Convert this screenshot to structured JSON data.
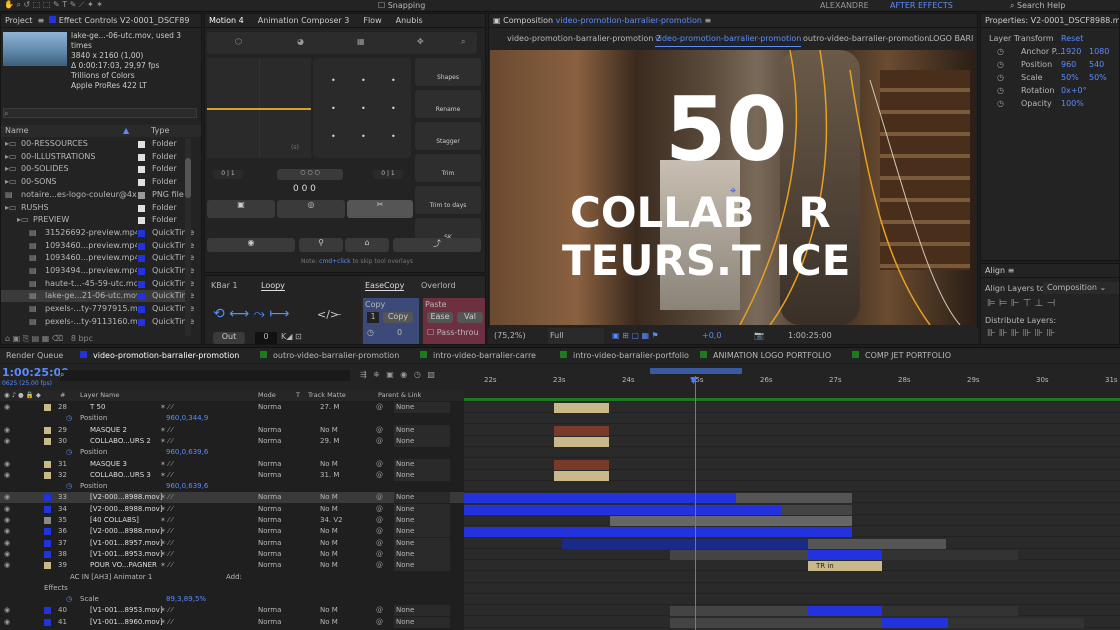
{
  "toolbar": {
    "user": "ALEXANDRE",
    "workspace": "AFTER EFFECTS",
    "search": "Search Help",
    "snapping": "Snapping"
  },
  "project": {
    "title": "Project",
    "effect_controls": "Effect Controls V2-0001_DSCF89",
    "file": "lake-ge...-06-utc.mov",
    "used": ", used 3 times",
    "res": "3840 x 2160 (1,00)",
    "dur": "Δ 0:00:17:03, 29,97 fps",
    "colors": "Trillions of Colors",
    "codec": "Apple ProRes 422 LT",
    "col_name": "Name",
    "col_type": "Type",
    "bpc": "8 bpc",
    "items": [
      {
        "name": "00-RESSOURCES",
        "type": "Folder",
        "color": "#e0e0e0"
      },
      {
        "name": "00-ILLUSTRATIONS",
        "type": "Folder",
        "color": "#e0e0e0"
      },
      {
        "name": "00-SOLIDES",
        "type": "Folder",
        "color": "#e0e0e0"
      },
      {
        "name": "00-SONS",
        "type": "Folder",
        "color": "#e0e0e0"
      },
      {
        "name": "notaire...es-logo-couleur@4x.png",
        "type": "PNG file",
        "color": "#9a9a9a"
      },
      {
        "name": "RUSHS",
        "type": "Folder",
        "color": "#e0e0e0"
      },
      {
        "name": "PREVIEW",
        "type": "Folder",
        "color": "#e0e0e0"
      },
      {
        "name": "31526692-preview.mp4",
        "type": "QuickTime",
        "color": "#2233dd"
      },
      {
        "name": "1093460...preview.mp4",
        "type": "QuickTime",
        "color": "#2233dd"
      },
      {
        "name": "1093460...preview.mp4",
        "type": "QuickTime",
        "color": "#2233dd"
      },
      {
        "name": "1093494...preview.mp4",
        "type": "QuickTime",
        "color": "#2233dd"
      },
      {
        "name": "haute-t...-45-59-utc.mov",
        "type": "QuickTime",
        "color": "#2233dd"
      },
      {
        "name": "lake-ge...21-06-utc.mov",
        "type": "QuickTime",
        "color": "#2233dd"
      },
      {
        "name": "pexels-...ty-7797915.mp4",
        "type": "QuickTime",
        "color": "#2233dd"
      },
      {
        "name": "pexels-...ty-9113160.mp4",
        "type": "QuickTime",
        "color": "#2233dd"
      }
    ]
  },
  "motion": {
    "tabs": [
      "Motion 4",
      "Animation Composer 3",
      "Flow",
      "Anubis"
    ],
    "side": [
      "Shapes",
      "Rename",
      "Stagger",
      "Trim",
      "Trim to days",
      "SK"
    ],
    "counter": "0 0 0",
    "hint_pre": "Note:",
    "hint_link": "cmd+click",
    "hint_post": "to skip tool overlays",
    "curve_label": "(s)"
  },
  "kbar": {
    "tabs": [
      "KBar 1",
      "Loopy",
      "EaseCopy",
      "Overlord"
    ],
    "out": "Out",
    "zero": "0",
    "copy": "Copy",
    "copy_btn": "Copy",
    "paste": "Paste",
    "ease": "Ease",
    "val": "Val",
    "pass": "Pass-throu",
    "count": "0",
    "one": "1"
  },
  "composition": {
    "tab": "Composition",
    "name": "video-promotion-barralier-promotion",
    "tabs": [
      "video-promotion-barralier-promotion 2",
      "video-promotion-barralier-promotion",
      "outro-video-barralier-promotion",
      "LOGO BARI"
    ],
    "big": "50",
    "line1": "COLLAB   R",
    "line2": "TEURS.T ICE",
    "zoom": "(75,2%)",
    "quality": "Full",
    "time": "1:00:25:00",
    "plus": "+0,0"
  },
  "properties": {
    "title": "Properties: V2-0001_DSCF8988.mov",
    "section": "Layer Transform",
    "reset": "Reset",
    "rows": [
      {
        "label": "Anchor P...",
        "v1": "1920",
        "v2": "1080"
      },
      {
        "label": "Position",
        "v1": "960",
        "v2": "540"
      },
      {
        "label": "Scale",
        "v1": "50%",
        "v2": "50%"
      },
      {
        "label": "Rotation",
        "v1": "0x+0°",
        "v2": ""
      },
      {
        "label": "Opacity",
        "v1": "100%",
        "v2": ""
      }
    ]
  },
  "align": {
    "title": "Align",
    "align_to": "Align Layers to:",
    "target": "Composition",
    "distribute": "Distribute Layers:"
  },
  "timeline": {
    "render_queue": "Render Queue",
    "tabs": [
      "video-promotion-barralier-promotion",
      "outro-video-barralier-promotion",
      "intro-video-barralier-carre",
      "intro-video-barralier-portfolio",
      "ANIMATION LOGO PORTFOLIO",
      "COMP JET PORTFOLIO"
    ],
    "timecode": "1:00:25:00",
    "fps": "0625 (25.00 fps)",
    "headers": {
      "num": "#",
      "name": "Layer Name",
      "mode": "Mode",
      "t": "T",
      "matte": "Track Matte",
      "parent": "Parent & Link"
    },
    "ruler": [
      "22s",
      "23s",
      "24s",
      "25s",
      "26s",
      "27s",
      "28s",
      "29s",
      "30s",
      "31s"
    ],
    "layers": [
      {
        "num": "28",
        "name": "T  50",
        "mode": "Norma",
        "matte": "27. M",
        "parent": "None",
        "color": "#c9b88a",
        "kind": "layer"
      },
      {
        "name": "Position",
        "value": "960,0,344,9",
        "kind": "prop"
      },
      {
        "num": "29",
        "name": "MASQUE 2",
        "mode": "Norma",
        "matte": "No M",
        "parent": "None",
        "color": "#c9b88a",
        "kind": "layer"
      },
      {
        "num": "30",
        "name": "COLLABO...URS 2",
        "mode": "Norma",
        "matte": "29. M",
        "parent": "None",
        "color": "#c9b88a",
        "kind": "layer"
      },
      {
        "name": "Position",
        "value": "960,0,639,6",
        "kind": "prop"
      },
      {
        "num": "31",
        "name": "MASQUE 3",
        "mode": "Norma",
        "matte": "No M",
        "parent": "None",
        "color": "#c9b88a",
        "kind": "layer"
      },
      {
        "num": "32",
        "name": "COLLABO...URS 3",
        "mode": "Norma",
        "matte": "31. M",
        "parent": "None",
        "color": "#c9b88a",
        "kind": "layer"
      },
      {
        "name": "Position",
        "value": "960,0,639,6",
        "kind": "prop"
      },
      {
        "num": "33",
        "name": "[V2-000...8988.mov]",
        "mode": "Norma",
        "matte": "No M",
        "parent": "None",
        "color": "#2233dd",
        "kind": "layer",
        "sel": true
      },
      {
        "num": "34",
        "name": "[V2-000...8988.mov]",
        "mode": "Norma",
        "matte": "No M",
        "parent": "None",
        "color": "#2233dd",
        "kind": "layer"
      },
      {
        "num": "35",
        "name": "[40 COLLABS]",
        "mode": "Norma",
        "matte": "34. V2",
        "parent": "None",
        "color": "#8a8a8a",
        "kind": "layer"
      },
      {
        "num": "36",
        "name": "[V2-000...8988.mov]",
        "mode": "Norma",
        "matte": "No M",
        "parent": "None",
        "color": "#2233dd",
        "kind": "layer"
      },
      {
        "num": "37",
        "name": "[V1-001...8957.mov]",
        "mode": "Norma",
        "matte": "No M",
        "parent": "None",
        "color": "#2233dd",
        "kind": "layer"
      },
      {
        "num": "38",
        "name": "[V1-001...8953.mov]",
        "mode": "Norma",
        "matte": "No M",
        "parent": "None",
        "color": "#2233dd",
        "kind": "layer"
      },
      {
        "num": "39",
        "name": "POUR VO...PAGNER",
        "mode": "Norma",
        "matte": "No M",
        "parent": "None",
        "color": "#c9b88a",
        "kind": "layer"
      },
      {
        "name": "AC IN [AH3] Animator 1",
        "value": "Add:",
        "kind": "sub"
      },
      {
        "name": "Effects",
        "value": "",
        "kind": "sub2"
      },
      {
        "name": "Scale",
        "value": "89,3,89,5%",
        "kind": "prop"
      },
      {
        "num": "40",
        "name": "[V1-001...8953.mov]",
        "mode": "Norma",
        "matte": "No M",
        "parent": "None",
        "color": "#2233dd",
        "kind": "layer"
      },
      {
        "num": "41",
        "name": "[V1-001...8960.mov]",
        "mode": "Norma",
        "matte": "No M",
        "parent": "None",
        "color": "#2233dd",
        "kind": "layer"
      }
    ],
    "tr_in": "TR in"
  }
}
